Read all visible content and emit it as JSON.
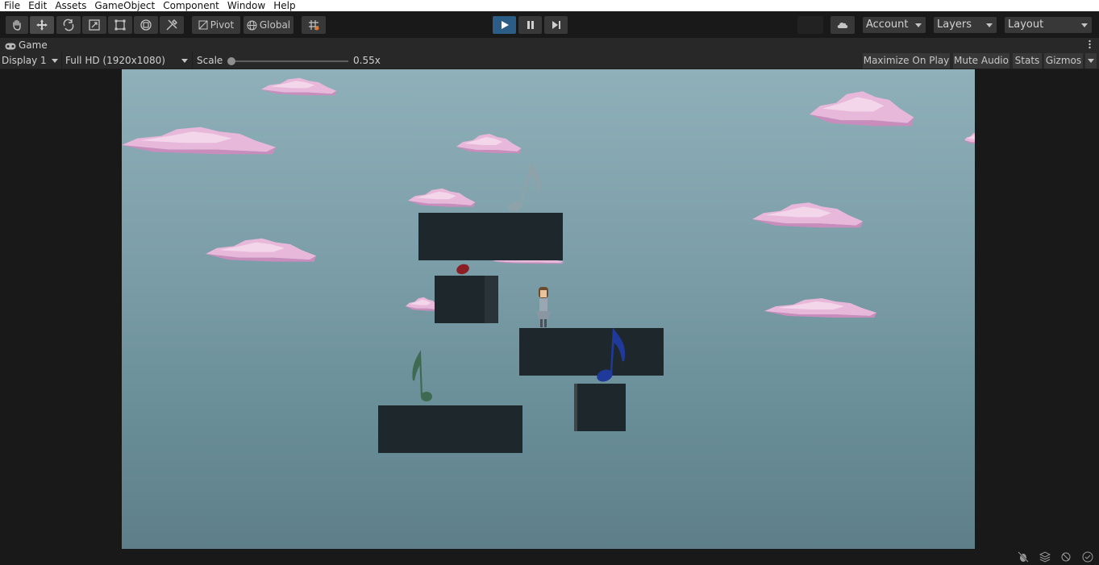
{
  "menu": {
    "items": [
      "File",
      "Edit",
      "Assets",
      "GameObject",
      "Component",
      "Window",
      "Help"
    ]
  },
  "toolbar": {
    "tools": [
      "hand-tool-icon",
      "move-tool-icon",
      "rotate-tool-icon",
      "scale-tool-icon",
      "rect-tool-icon",
      "transform-tool-icon",
      "custom-tool-icon"
    ],
    "pivot_label": "Pivot",
    "global_label": "Global",
    "account_label": "Account",
    "layers_label": "Layers",
    "layout_label": "Layout"
  },
  "game_tab": {
    "title": "Game"
  },
  "game_controls": {
    "display": "Display 1",
    "resolution": "Full HD (1920x1080)",
    "scale_label": "Scale",
    "scale_value": "0.55x",
    "maximize_label": "Maximize On Play",
    "mute_label": "Mute Audio",
    "stats_label": "Stats",
    "gizmos_label": "Gizmos"
  },
  "colors": {
    "play_active": "#2c5d87",
    "cloud_pink": "#e6b3da",
    "note_grey": "#8ea2aa",
    "note_red": "#8b1e24",
    "note_blue": "#1f3a9a",
    "note_green": "#3f6a52"
  }
}
